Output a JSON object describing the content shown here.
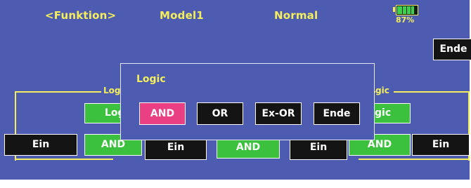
{
  "header": {
    "function_label": "<Funktion>",
    "model_label": "Model1",
    "condition_label": "Normal",
    "battery": {
      "percent_text": "87%",
      "level": 0.87
    }
  },
  "top_button": {
    "label": "Ende"
  },
  "left_group": {
    "title": "Logi",
    "logic_button": "Log",
    "row_buttons": [
      "Ein",
      "AND",
      "Ein"
    ]
  },
  "middle": {
    "hidden_button": "AND"
  },
  "right_group": {
    "title": "gic",
    "logic_button": "gic",
    "row_buttons": [
      "Ein",
      "AND",
      "Ein"
    ]
  },
  "dialog": {
    "title": "Logic",
    "options": [
      {
        "label": "AND",
        "selected": true
      },
      {
        "label": "OR",
        "selected": false
      },
      {
        "label": "Ex-OR",
        "selected": false
      },
      {
        "label": "Ende",
        "selected": false
      }
    ]
  },
  "colors": {
    "background": "#4d5cb1",
    "title_yellow": "#f4ee5c",
    "green": "#3cc13f",
    "pink_selected": "#ea3f82",
    "button_dark": "#141414"
  }
}
